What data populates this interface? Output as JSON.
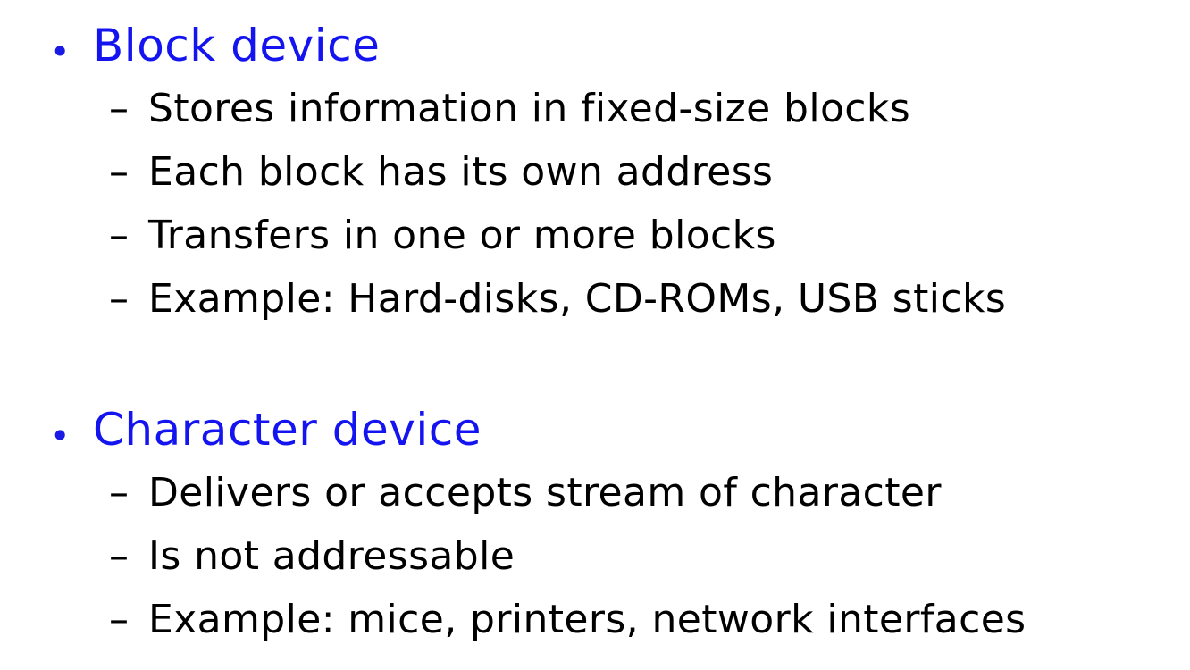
{
  "sections": [
    {
      "heading": "Block device",
      "items": [
        "Stores information in fixed-size blocks",
        "Each block has its own address",
        "Transfers in one or more blocks",
        "Example: Hard-disks, CD-ROMs, USB sticks"
      ]
    },
    {
      "heading": "Character device",
      "items": [
        "Delivers or accepts stream of character",
        "Is not addressable",
        "Example: mice, printers, network interfaces"
      ]
    }
  ],
  "bullet_glyph": "•",
  "dash_glyph": "–",
  "colors": {
    "heading": "#1414f0",
    "body": "#000000",
    "background": "#ffffff"
  }
}
